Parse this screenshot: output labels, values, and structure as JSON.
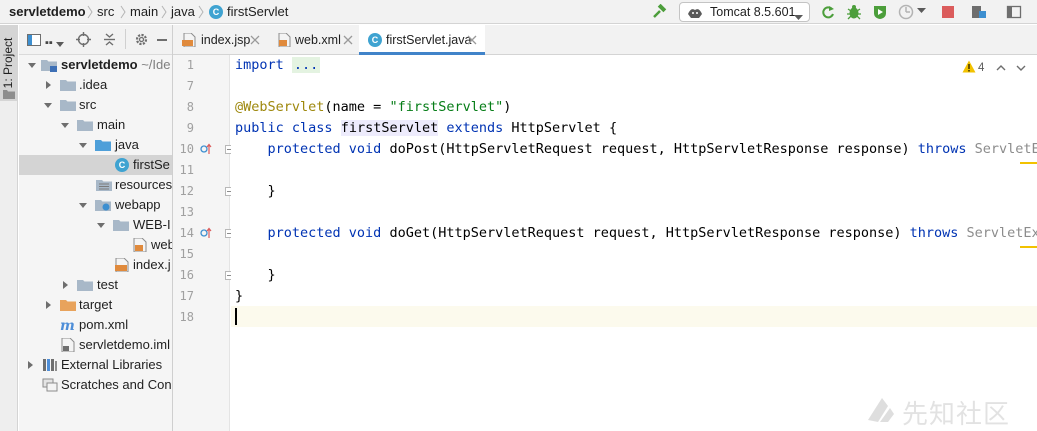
{
  "breadcrumbs": [
    "servletdemo",
    "src",
    "main",
    "java",
    "firstServlet"
  ],
  "toolbar": {
    "run_configuration": "Tomcat 8.5.601",
    "icons": [
      "build-hammer-icon",
      "run-config-tomcat-icon",
      "rerun-icon",
      "debug-icon",
      "coverage-icon",
      "profile-icon",
      "stop-icon",
      "project-structure-icon",
      "window-icon"
    ]
  },
  "side_stripe": {
    "project_tab": "1: Project"
  },
  "project_tree": [
    {
      "label": "servletdemo",
      "sub": " ~/Ide",
      "icon": "module-folder-icon",
      "expanded": true,
      "bold": true
    },
    {
      "label": ".idea",
      "icon": "folder-icon",
      "expanded": false
    },
    {
      "label": "src",
      "icon": "folder-icon",
      "expanded": true
    },
    {
      "label": "main",
      "icon": "folder-icon",
      "expanded": true
    },
    {
      "label": "java",
      "icon": "source-folder-icon",
      "expanded": true
    },
    {
      "label": "firstSe",
      "icon": "java-class-icon",
      "selected": true
    },
    {
      "label": "resources",
      "icon": "resources-folder-icon"
    },
    {
      "label": "webapp",
      "icon": "web-folder-icon",
      "expanded": true
    },
    {
      "label": "WEB-I",
      "icon": "folder-icon",
      "expanded": true
    },
    {
      "label": "web",
      "icon": "xml-file-icon"
    },
    {
      "label": "index.j",
      "icon": "jsp-file-icon"
    },
    {
      "label": "test",
      "icon": "folder-icon",
      "expanded": false
    },
    {
      "label": "target",
      "icon": "excluded-folder-icon",
      "expanded": false
    },
    {
      "label": "pom.xml",
      "icon": "maven-icon"
    },
    {
      "label": "servletdemo.iml",
      "icon": "iml-file-icon"
    },
    {
      "label": "External Libraries",
      "icon": "library-icon",
      "expanded": false
    },
    {
      "label": "Scratches and Con",
      "icon": "scratches-icon"
    }
  ],
  "editor_tabs": [
    {
      "label": "index.jsp",
      "icon": "jsp-file-icon",
      "active": false
    },
    {
      "label": "web.xml",
      "icon": "xml-file-icon",
      "active": false
    },
    {
      "label": "firstServlet.java",
      "icon": "java-class-icon",
      "active": true
    }
  ],
  "editor": {
    "line_numbers": [
      "1",
      "7",
      "8",
      "9",
      "10",
      "11",
      "12",
      "13",
      "14",
      "15",
      "16",
      "17",
      "18"
    ],
    "inspections": {
      "warning_count": "4"
    },
    "code": {
      "l1_kw": "import",
      "l1_fold": "...",
      "l8_ann": "@WebServlet",
      "l8_open": "(name = ",
      "l8_str": "\"firstServlet\"",
      "l8_close": ")",
      "l9_kw1": "public class",
      "l9_name": "firstServlet",
      "l9_kw2": "extends",
      "l9_rest": " HttpServlet {",
      "l10_kw": "protected void",
      "l10_sig": " doPost(HttpServletRequest request, HttpServletResponse response) ",
      "l10_throws": "throws",
      "l10_exc": " ServletEx",
      "l12": "}",
      "l14_kw": "protected void",
      "l14_sig": " doGet(HttpServletRequest request, HttpServletResponse response) ",
      "l14_throws": "throws",
      "l14_exc": " ServletExc",
      "l16": "}",
      "l17": "}"
    }
  },
  "watermark": "先知社区",
  "colors": {
    "keyword": "#0033b3",
    "annotation": "#9e880d",
    "string": "#067d17",
    "selection": "#d4d4d4",
    "active_tab_underline": "#4083c9",
    "class_badge": "#3fa3d1",
    "warning": "#f2c200"
  }
}
